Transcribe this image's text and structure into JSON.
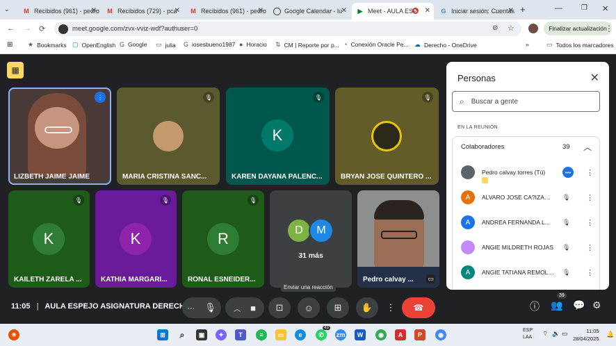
{
  "browser": {
    "tabs": [
      {
        "title": "Recibidos (961) - pedro",
        "icon": "gmail-icon"
      },
      {
        "title": "Recibidos (729) - pca",
        "icon": "gmail-icon"
      },
      {
        "title": "Recibidos (961) - pedro",
        "icon": "gmail-icon"
      },
      {
        "title": "Google Calendar - lu",
        "icon": "globe-icon"
      },
      {
        "title": "Meet - AULA ESP",
        "icon": "meet-icon",
        "active": true
      },
      {
        "title": "Iniciar sesión: Cuentas",
        "icon": "google-icon"
      }
    ],
    "url": "meet.google.com/zvx-vviz-wdf?authuser=0",
    "update_button": "Finalizar actualización",
    "bookmarks": [
      "Bookmarks",
      "OpenEnglish",
      "Google",
      "julia",
      "iosesbueno1987",
      "Horacio",
      "CM | Reporte por p...",
      "Conexión Oracle Pe...",
      "Derecho - OneDrive"
    ],
    "all_bookmarks": "Todos los marcadores"
  },
  "participants": [
    {
      "name": "LIZBETH JAIME JAIME",
      "type": "video",
      "speaking": true
    },
    {
      "name": "MARIA CRISTINA SANC...",
      "type": "photo",
      "bg": "#5b5a2e"
    },
    {
      "name": "KAREN DAYANA PALENC...",
      "type": "letter",
      "letter": "K",
      "bg": "#00574b",
      "avatar_color": "#00796b"
    },
    {
      "name": "BRYAN JOSE QUINTERO ...",
      "type": "photo",
      "bg": "#615c28"
    },
    {
      "name": "KAILETH ZARELA ...",
      "type": "letter",
      "letter": "K",
      "bg": "#1e5b18",
      "avatar_color": "#2e7d32"
    },
    {
      "name": "KATHIA MARGARI...",
      "type": "letter",
      "letter": "K",
      "bg": "#6a1b9a",
      "avatar_color": "#8e24aa"
    },
    {
      "name": "RONAL ESNEIDER...",
      "type": "letter",
      "letter": "R",
      "bg": "#1e5b18",
      "avatar_color": "#2e7d32"
    },
    {
      "name": "Pedro calvay ...",
      "type": "video"
    }
  ],
  "more_tile": {
    "avatars": [
      "D",
      "M"
    ],
    "label": "31 más"
  },
  "meeting": {
    "time": "11:05",
    "title": "AULA ESPEJO ASIGNATURA DERECH...",
    "reaction_tooltip": "Enviar una reacción",
    "people_badge": "39"
  },
  "panel": {
    "title": "Personas",
    "search_placeholder": "Buscar a gente",
    "section": "EN LA REUNIÓN",
    "group": "Colaboradores",
    "count": "39",
    "people": [
      {
        "name": "Pedro calvay torres (Tú)",
        "letter": "",
        "color": "#5f6368"
      },
      {
        "name": "ALVARO JOSE CA?IZARES",
        "letter": "A",
        "color": "#e8710a"
      },
      {
        "name": "ANDREA FERNANDA L...",
        "letter": "A",
        "color": "#1a73e8"
      },
      {
        "name": "ANGIE MILDRETH ROJAS",
        "letter": "",
        "color": "#c58af9"
      },
      {
        "name": "ANGIE TATIANA REMOLINA",
        "letter": "A",
        "color": "#00897b"
      }
    ]
  },
  "taskbar": {
    "lang": "ESP",
    "lang2": "LAA",
    "time": "11:05",
    "date": "28/04/2025",
    "badge_whatsapp": "43"
  }
}
